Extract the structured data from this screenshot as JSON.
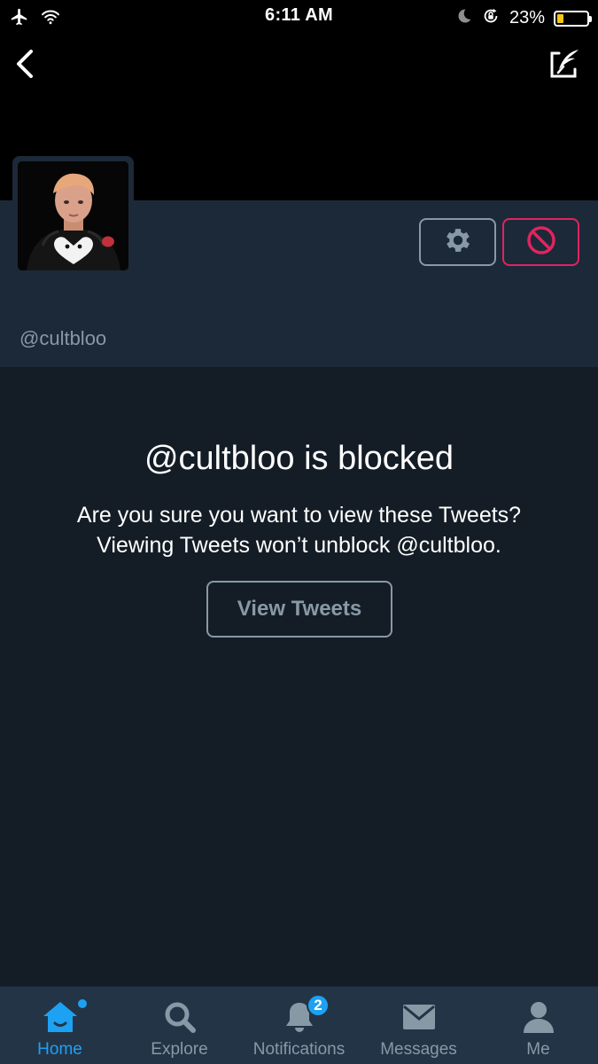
{
  "status_bar": {
    "time": "6:11 AM",
    "battery_percent": "23%",
    "battery_level": 0.23,
    "battery_color": "#f5c518"
  },
  "header": {
    "back_icon": "chevron-left-icon",
    "compose_icon": "compose-quill-icon"
  },
  "profile": {
    "handle": "@cultbloo",
    "settings_icon": "gear-icon",
    "block_icon": "block-icon",
    "block_color": "#e0245e"
  },
  "blocked": {
    "title": "@cultbloo is blocked",
    "line1": "Are you sure you want to view these Tweets?",
    "line2": "Viewing Tweets won’t unblock @cultbloo.",
    "button_label": "View Tweets"
  },
  "tabs": [
    {
      "label": "Home",
      "icon": "home-icon",
      "active": true
    },
    {
      "label": "Explore",
      "icon": "search-icon",
      "active": false
    },
    {
      "label": "Notifications",
      "icon": "bell-icon",
      "active": false,
      "badge": "2"
    },
    {
      "label": "Messages",
      "icon": "envelope-icon",
      "active": false
    },
    {
      "label": "Me",
      "icon": "person-icon",
      "active": false
    }
  ],
  "colors": {
    "accent": "#1da1f2",
    "muted": "#8899a6",
    "header_bg": "#1c2938",
    "body_bg": "#141d26",
    "tab_bg": "#243447"
  }
}
